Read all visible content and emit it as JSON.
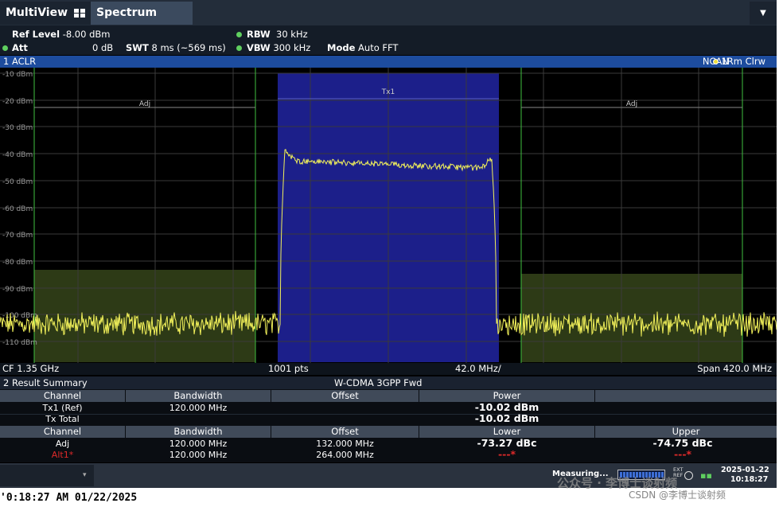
{
  "tabs": {
    "multiview": "MultiView",
    "spectrum": "Spectrum",
    "menu_icon": "chevron-down-icon"
  },
  "settings": {
    "ref_level_label": "Ref Level",
    "ref_level_value": "-8.00 dBm",
    "att_label": "Att",
    "att_value": "0 dB",
    "swt_label": "SWT",
    "swt_value": "8 ms (~569 ms)",
    "rbw_label": "RBW",
    "rbw_value": "30 kHz",
    "vbw_label": "VBW",
    "vbw_value": "300 kHz",
    "mode_label": "Mode",
    "mode_value": "Auto FFT"
  },
  "diagram": {
    "title": "1 ACLR",
    "ncan": "NCAN",
    "trace": "1Rm Clrw",
    "y_ticks": [
      "-10 dBm",
      "-20 dBm",
      "-30 dBm",
      "-40 dBm",
      "-50 dBm",
      "-60 dBm",
      "-70 dBm",
      "-80 dBm",
      "-90 dBm",
      "-100 dBm",
      "-110 dBm"
    ],
    "channel_labels": {
      "tx": "Tx1",
      "adj_left": "Adj",
      "adj_right": "Adj"
    }
  },
  "chart_data": {
    "type": "line",
    "ylim": [
      -113,
      -8
    ],
    "xlim": [
      1140,
      1560
    ],
    "x_unit": "MHz",
    "y_unit": "dBm",
    "points": 1001,
    "series": [
      {
        "values_approx": {
          "noise_floor": -103.5,
          "tx_top_center": -44,
          "tx_edge_left": -42.5,
          "tx_edge_right": -45.5
        }
      }
    ],
    "channels": [
      {
        "name": "Tx1",
        "bandwidth_mhz": 120,
        "offset_mhz": 0,
        "power_dbm": -10.02
      },
      {
        "name": "Adj",
        "bandwidth_mhz": 120,
        "offset_mhz": 132,
        "limit_dbm": -84
      },
      {
        "name": "Adj",
        "bandwidth_mhz": 120,
        "offset_mhz": -132,
        "limit_dbm": -86
      }
    ]
  },
  "footer": {
    "cf": "CF 1.35 GHz",
    "pts": "1001 pts",
    "div": "42.0 MHz/",
    "span": "Span 420.0 MHz"
  },
  "result": {
    "title": "2 Result Summary",
    "standard": "W-CDMA 3GPP Fwd",
    "header1": {
      "channel": "Channel",
      "bandwidth": "Bandwidth",
      "offset": "Offset",
      "power": "Power"
    },
    "tx_rows": [
      {
        "channel": "Tx1 (Ref)",
        "bandwidth": "120.000 MHz",
        "power": "-10.02 dBm"
      },
      {
        "channel": "Tx Total",
        "power": "-10.02 dBm"
      }
    ],
    "header2": {
      "channel": "Channel",
      "bandwidth": "Bandwidth",
      "offset": "Offset",
      "lower": "Lower",
      "upper": "Upper"
    },
    "adj_rows": [
      {
        "channel": "Adj",
        "bandwidth": "120.000 MHz",
        "offset": "132.000 MHz",
        "lower": "-73.27 dBc",
        "upper": "-74.75 dBc"
      },
      {
        "channel": "Alt1*",
        "bandwidth": "120.000 MHz",
        "offset": "264.000 MHz",
        "lower": "---*",
        "upper": "---*"
      }
    ]
  },
  "status": {
    "measuring": "Measuring...",
    "ext_ref": "EXT REF",
    "date": "2025-01-22",
    "time": "10:18:27"
  },
  "bottom_timestamp": "'0:18:27 AM 01/22/2025",
  "watermark": {
    "wechat": "公众号 · 李博士谈射频",
    "csdn": "CSDN @李博士谈射频"
  },
  "colors": {
    "trace": "#f1f05a",
    "tx_band": "#1c1f8a",
    "adj_band": "#2d3a16",
    "green_line": "#3fbf3f",
    "header_blue": "#1d4c9e"
  }
}
